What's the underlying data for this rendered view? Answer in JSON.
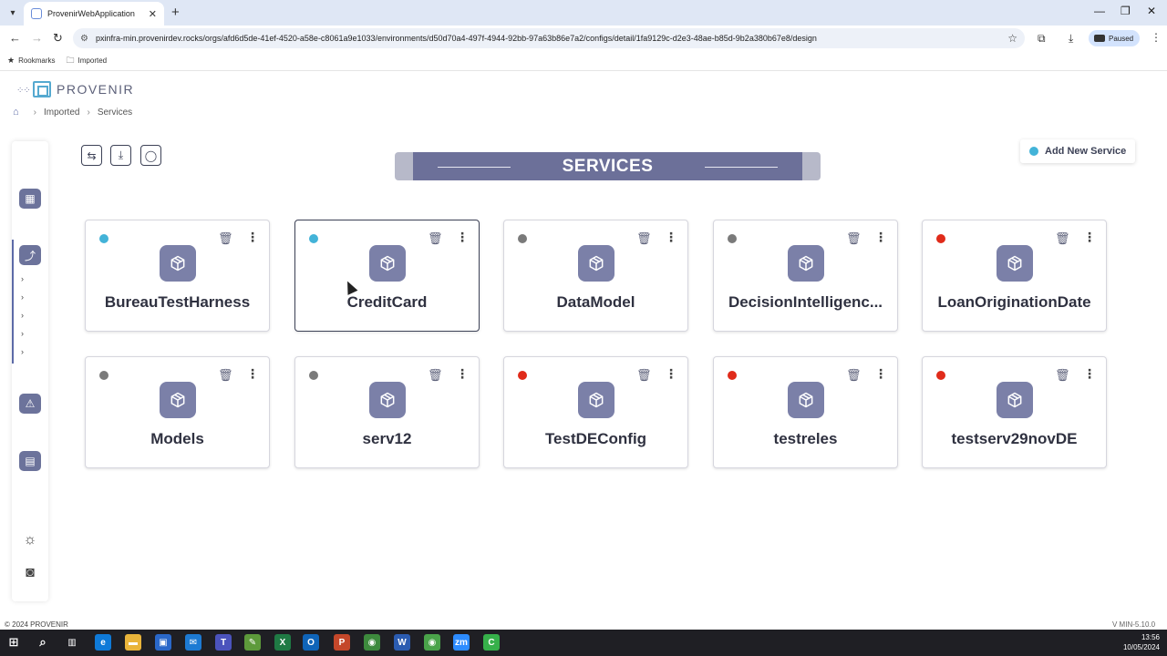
{
  "browser": {
    "tab_title": "ProvenirWebApplication",
    "tab_close": "✕",
    "new_tab": "+",
    "url": "pxinfra-min.provenirdev.rocks/orgs/afd6d5de-41ef-4520-a58e-c8061a9e1033/environments/d50d70a4-497f-4944-92bb-97a63b86e7a2/configs/detail/1fa9129c-d2e3-48ae-b85d-9b2a380b67e8/design",
    "profile_status": "Paused",
    "bookmarks": [
      {
        "label": "Rookmarks",
        "icon": "star-icon"
      },
      {
        "label": "Imported",
        "icon": "folder-icon"
      }
    ]
  },
  "app": {
    "logo_text": "PROVENIR",
    "breadcrumb": [
      "Imported",
      "Services"
    ],
    "page_title": "SERVICES",
    "add_service_label": "Add New Service",
    "footer_copyright": "© 2024 PROVENIR",
    "footer_version": "V MIN-5.10.0"
  },
  "colors": {
    "accent": "#6c7099",
    "status_active": "#43b3d8",
    "status_inactive": "#7a7a7a",
    "status_error": "#e02b1a"
  },
  "services": [
    {
      "name": "BureauTestHarness",
      "status": "active",
      "selected": false
    },
    {
      "name": "CreditCard",
      "status": "active",
      "selected": true
    },
    {
      "name": "DataModel",
      "status": "inactive",
      "selected": false
    },
    {
      "name": "DecisionIntelligenc...",
      "status": "inactive",
      "selected": false
    },
    {
      "name": "LoanOriginationDate",
      "status": "error",
      "selected": false
    },
    {
      "name": "Models",
      "status": "inactive",
      "selected": false
    },
    {
      "name": "serv12",
      "status": "inactive",
      "selected": false
    },
    {
      "name": "TestDEConfig",
      "status": "error",
      "selected": false
    },
    {
      "name": "testreles",
      "status": "error",
      "selected": false
    },
    {
      "name": "testserv29novDE",
      "status": "error",
      "selected": false
    }
  ],
  "taskbar": {
    "time": "13:56",
    "date": "10/05/2024"
  }
}
